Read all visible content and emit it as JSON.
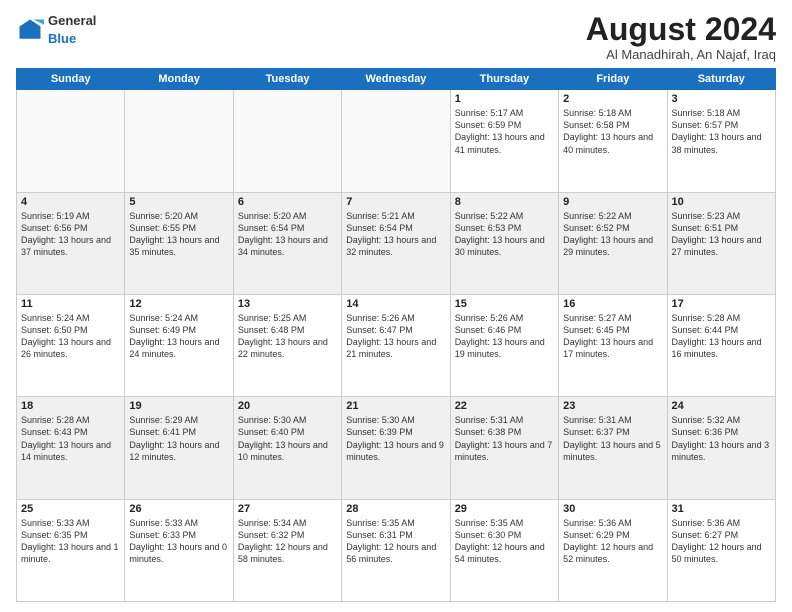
{
  "logo": {
    "general": "General",
    "blue": "Blue"
  },
  "header": {
    "month_year": "August 2024",
    "location": "Al Manadhirah, An Najaf, Iraq"
  },
  "days_of_week": [
    "Sunday",
    "Monday",
    "Tuesday",
    "Wednesday",
    "Thursday",
    "Friday",
    "Saturday"
  ],
  "weeks": [
    [
      {
        "day": "",
        "content": ""
      },
      {
        "day": "",
        "content": ""
      },
      {
        "day": "",
        "content": ""
      },
      {
        "day": "",
        "content": ""
      },
      {
        "day": "1",
        "content": "Sunrise: 5:17 AM\nSunset: 6:59 PM\nDaylight: 13 hours\nand 41 minutes."
      },
      {
        "day": "2",
        "content": "Sunrise: 5:18 AM\nSunset: 6:58 PM\nDaylight: 13 hours\nand 40 minutes."
      },
      {
        "day": "3",
        "content": "Sunrise: 5:18 AM\nSunset: 6:57 PM\nDaylight: 13 hours\nand 38 minutes."
      }
    ],
    [
      {
        "day": "4",
        "content": "Sunrise: 5:19 AM\nSunset: 6:56 PM\nDaylight: 13 hours\nand 37 minutes."
      },
      {
        "day": "5",
        "content": "Sunrise: 5:20 AM\nSunset: 6:55 PM\nDaylight: 13 hours\nand 35 minutes."
      },
      {
        "day": "6",
        "content": "Sunrise: 5:20 AM\nSunset: 6:54 PM\nDaylight: 13 hours\nand 34 minutes."
      },
      {
        "day": "7",
        "content": "Sunrise: 5:21 AM\nSunset: 6:54 PM\nDaylight: 13 hours\nand 32 minutes."
      },
      {
        "day": "8",
        "content": "Sunrise: 5:22 AM\nSunset: 6:53 PM\nDaylight: 13 hours\nand 30 minutes."
      },
      {
        "day": "9",
        "content": "Sunrise: 5:22 AM\nSunset: 6:52 PM\nDaylight: 13 hours\nand 29 minutes."
      },
      {
        "day": "10",
        "content": "Sunrise: 5:23 AM\nSunset: 6:51 PM\nDaylight: 13 hours\nand 27 minutes."
      }
    ],
    [
      {
        "day": "11",
        "content": "Sunrise: 5:24 AM\nSunset: 6:50 PM\nDaylight: 13 hours\nand 26 minutes."
      },
      {
        "day": "12",
        "content": "Sunrise: 5:24 AM\nSunset: 6:49 PM\nDaylight: 13 hours\nand 24 minutes."
      },
      {
        "day": "13",
        "content": "Sunrise: 5:25 AM\nSunset: 6:48 PM\nDaylight: 13 hours\nand 22 minutes."
      },
      {
        "day": "14",
        "content": "Sunrise: 5:26 AM\nSunset: 6:47 PM\nDaylight: 13 hours\nand 21 minutes."
      },
      {
        "day": "15",
        "content": "Sunrise: 5:26 AM\nSunset: 6:46 PM\nDaylight: 13 hours\nand 19 minutes."
      },
      {
        "day": "16",
        "content": "Sunrise: 5:27 AM\nSunset: 6:45 PM\nDaylight: 13 hours\nand 17 minutes."
      },
      {
        "day": "17",
        "content": "Sunrise: 5:28 AM\nSunset: 6:44 PM\nDaylight: 13 hours\nand 16 minutes."
      }
    ],
    [
      {
        "day": "18",
        "content": "Sunrise: 5:28 AM\nSunset: 6:43 PM\nDaylight: 13 hours\nand 14 minutes."
      },
      {
        "day": "19",
        "content": "Sunrise: 5:29 AM\nSunset: 6:41 PM\nDaylight: 13 hours\nand 12 minutes."
      },
      {
        "day": "20",
        "content": "Sunrise: 5:30 AM\nSunset: 6:40 PM\nDaylight: 13 hours\nand 10 minutes."
      },
      {
        "day": "21",
        "content": "Sunrise: 5:30 AM\nSunset: 6:39 PM\nDaylight: 13 hours\nand 9 minutes."
      },
      {
        "day": "22",
        "content": "Sunrise: 5:31 AM\nSunset: 6:38 PM\nDaylight: 13 hours\nand 7 minutes."
      },
      {
        "day": "23",
        "content": "Sunrise: 5:31 AM\nSunset: 6:37 PM\nDaylight: 13 hours\nand 5 minutes."
      },
      {
        "day": "24",
        "content": "Sunrise: 5:32 AM\nSunset: 6:36 PM\nDaylight: 13 hours\nand 3 minutes."
      }
    ],
    [
      {
        "day": "25",
        "content": "Sunrise: 5:33 AM\nSunset: 6:35 PM\nDaylight: 13 hours\nand 1 minute."
      },
      {
        "day": "26",
        "content": "Sunrise: 5:33 AM\nSunset: 6:33 PM\nDaylight: 13 hours\nand 0 minutes."
      },
      {
        "day": "27",
        "content": "Sunrise: 5:34 AM\nSunset: 6:32 PM\nDaylight: 12 hours\nand 58 minutes."
      },
      {
        "day": "28",
        "content": "Sunrise: 5:35 AM\nSunset: 6:31 PM\nDaylight: 12 hours\nand 56 minutes."
      },
      {
        "day": "29",
        "content": "Sunrise: 5:35 AM\nSunset: 6:30 PM\nDaylight: 12 hours\nand 54 minutes."
      },
      {
        "day": "30",
        "content": "Sunrise: 5:36 AM\nSunset: 6:29 PM\nDaylight: 12 hours\nand 52 minutes."
      },
      {
        "day": "31",
        "content": "Sunrise: 5:36 AM\nSunset: 6:27 PM\nDaylight: 12 hours\nand 50 minutes."
      }
    ]
  ]
}
